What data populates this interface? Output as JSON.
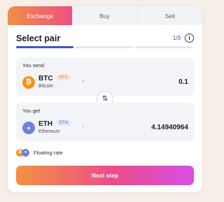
{
  "tabs": [
    {
      "label": "Exchange",
      "active": true
    },
    {
      "label": "Buy",
      "active": false
    },
    {
      "label": "Sell",
      "active": false
    }
  ],
  "header": {
    "title": "Select pair",
    "step": "1/3",
    "info_icon": "info-icon"
  },
  "progress": {
    "current_step": 1,
    "total_steps": 3
  },
  "send": {
    "label": "You send",
    "coin_symbol": "BTC",
    "coin_badge": "BTC",
    "coin_name": "Bitcoin",
    "coin_icon_char": "₿",
    "amount": "0.1"
  },
  "get": {
    "label": "You get",
    "coin_symbol": "ETH",
    "coin_badge": "ETH",
    "coin_name": "Ethereum",
    "coin_icon_char": "♦",
    "amount": "4.14940964"
  },
  "swap_icon": "⇅",
  "rate": {
    "label": "Floating rate",
    "btc_icon_char": "₿",
    "eth_icon_char": "♦"
  },
  "next_button": "Next step",
  "colors": {
    "accent_blue": "#4752c9",
    "btc_orange": "#f7931a",
    "eth_blue": "#6e82d8",
    "gradient_start": "#f3923f",
    "gradient_end": "#d84ee6"
  }
}
